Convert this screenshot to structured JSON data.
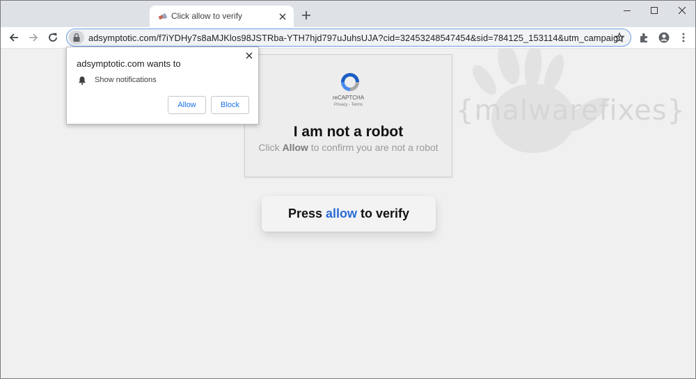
{
  "browser": {
    "tab_title": "Click allow to verify",
    "url": "adsymptotic.com/f7iYDHy7s8aMJKlos98JSTRba-YTH7hjd797uJuhsUJA?cid=32453248547454&sid=784125_153114&utm_campaign",
    "icons": [
      "favicon-icon",
      "close-icon",
      "plus-icon",
      "minimize-icon",
      "maximize-icon",
      "close-window-icon",
      "back-icon",
      "forward-icon",
      "reload-icon",
      "lock-icon",
      "star-icon",
      "extensions-icon",
      "profile-icon",
      "menu-icon"
    ]
  },
  "notification_popup": {
    "title": "adsymptotic.com wants to",
    "permission": "Show notifications",
    "allow_label": "Allow",
    "block_label": "Block"
  },
  "captcha": {
    "logo_label": "reCAPTCHA",
    "links": "Privacy - Terms",
    "title": "I am not a robot",
    "sub_prefix": "Click",
    "sub_bold": "Allow",
    "sub_suffix": "to confirm you are not a robot"
  },
  "press_button": {
    "prefix": "Press",
    "highlight": "allow",
    "suffix": "to verify"
  },
  "watermark": {
    "text": "{malwarefixes}"
  },
  "colors": {
    "accent_blue": "#2a6bd6",
    "chrome_titlebar": "#dee1e6",
    "page_bg": "#f0f0f0"
  }
}
